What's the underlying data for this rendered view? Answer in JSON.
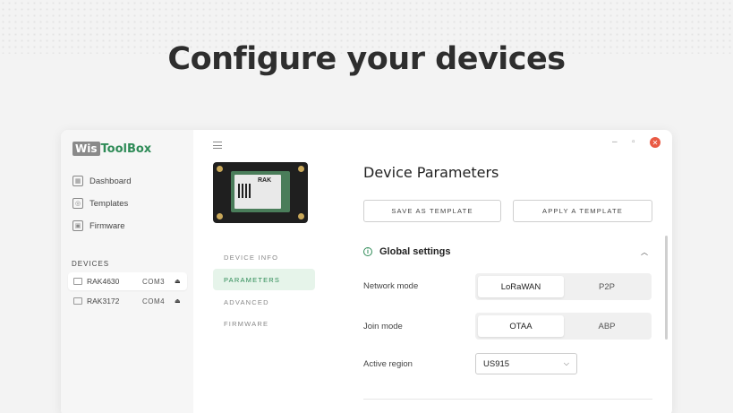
{
  "headline": "Configure your devices",
  "app": {
    "logo_wis": "Wis",
    "logo_tool": "ToolBox",
    "nav": [
      {
        "label": "Dashboard",
        "icon": "dashboard-icon"
      },
      {
        "label": "Templates",
        "icon": "templates-icon"
      },
      {
        "label": "Firmware",
        "icon": "firmware-icon"
      }
    ],
    "devices_title": "DEVICES",
    "devices": [
      {
        "name": "RAK4630",
        "port": "COM3",
        "active": true
      },
      {
        "name": "RAK3172",
        "port": "COM4",
        "active": false
      }
    ],
    "device_image_label": "RAK",
    "tabs": [
      "DEVICE INFO",
      "PARAMETERS",
      "ADVANCED",
      "FIRMWARE"
    ],
    "active_tab": "PARAMETERS",
    "title": "Device Parameters",
    "buttons": {
      "save_template": "SAVE AS TEMPLATE",
      "apply_template": "APPLY A TEMPLATE"
    },
    "section": "Global settings",
    "network_mode": {
      "label": "Network mode",
      "options": [
        "LoRaWAN",
        "P2P"
      ],
      "selected": "LoRaWAN"
    },
    "join_mode": {
      "label": "Join mode",
      "options": [
        "OTAA",
        "ABP"
      ],
      "selected": "OTAA"
    },
    "active_region": {
      "label": "Active region",
      "value": "US915"
    },
    "colors": {
      "accent": "#2e8b57",
      "close": "#e95a44",
      "active_tab_bg": "#e6f4ea"
    }
  }
}
